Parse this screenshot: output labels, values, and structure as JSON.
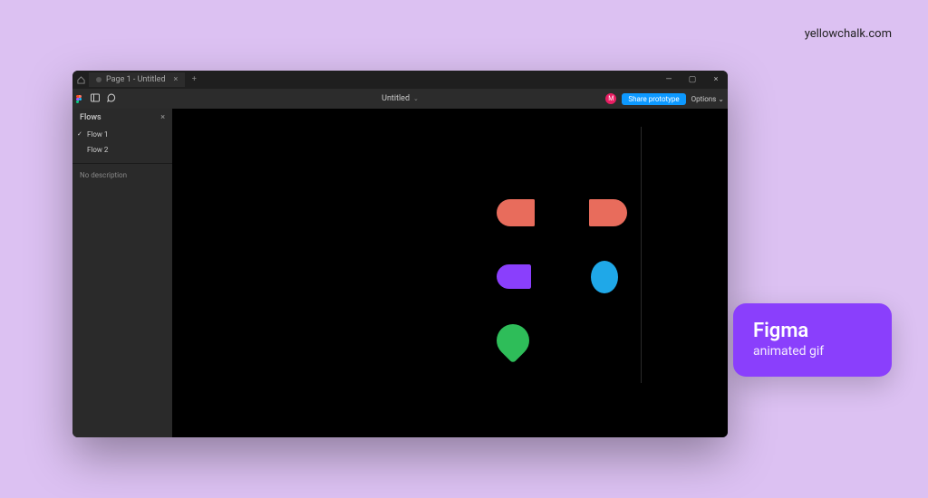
{
  "watermark": "yellowchalk.com",
  "titlebar": {
    "tab_label": "Page 1 - Untitled",
    "close_x": "×",
    "newtab": "+",
    "min": "—",
    "max": "▢",
    "close": "×"
  },
  "toolbar": {
    "doc_title": "Untitled",
    "chevron": "⌄",
    "avatar_initial": "M",
    "share_label": "Share prototype",
    "options_label": "Options",
    "options_chev": "⌄"
  },
  "sidebar": {
    "panel_title": "Flows",
    "close_x": "×",
    "flows": [
      {
        "label": "Flow 1",
        "active": true
      },
      {
        "label": "Flow 2",
        "active": false
      }
    ],
    "description": "No description"
  },
  "card": {
    "title": "Figma",
    "subtitle": "animated gif"
  }
}
